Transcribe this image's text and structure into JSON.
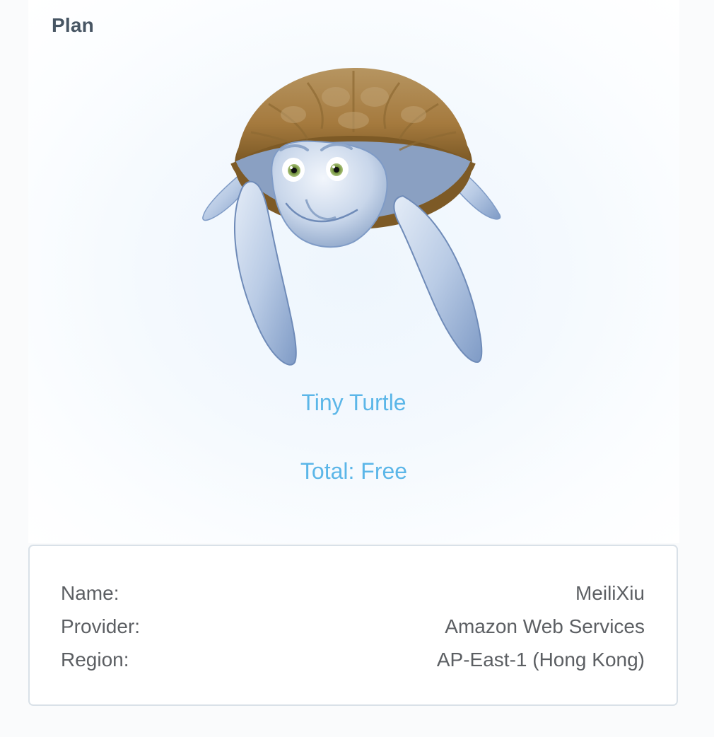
{
  "plan": {
    "heading": "Plan",
    "mascot_icon": "turtle-icon",
    "name": "Tiny Turtle",
    "total": "Total: Free",
    "accent_color": "#5bb6e8"
  },
  "details": {
    "rows": [
      {
        "label": "Name:",
        "value": "MeiliXiu"
      },
      {
        "label": "Provider:",
        "value": "Amazon Web Services"
      },
      {
        "label": "Region:",
        "value": "AP-East-1 (Hong Kong)"
      }
    ]
  }
}
